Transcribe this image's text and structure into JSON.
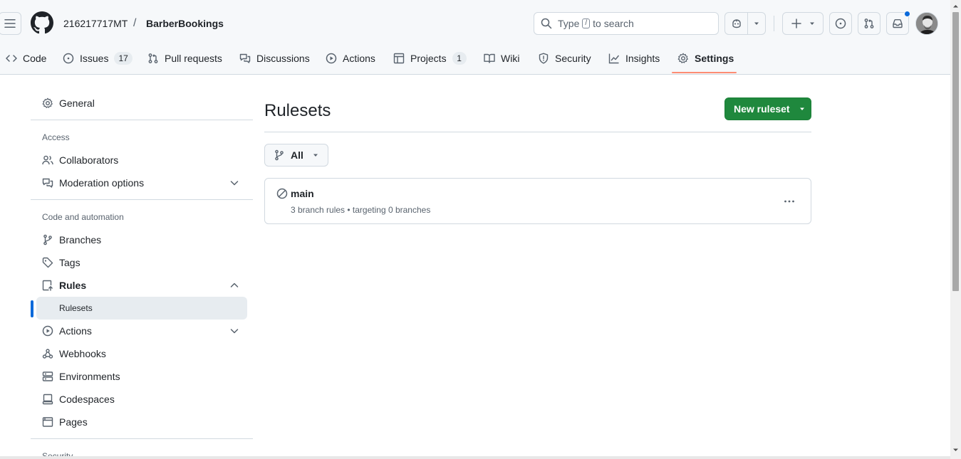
{
  "header": {
    "owner": "216217717MT",
    "separator": "/",
    "repo": "BarberBookings",
    "search": {
      "prefix": "Type",
      "key": "/",
      "suffix": "to search"
    }
  },
  "repo_nav": [
    {
      "label": "Code",
      "icon": "code-icon"
    },
    {
      "label": "Issues",
      "icon": "issue-opened-icon",
      "count": "17"
    },
    {
      "label": "Pull requests",
      "icon": "git-pull-request-icon"
    },
    {
      "label": "Discussions",
      "icon": "comment-discussion-icon"
    },
    {
      "label": "Actions",
      "icon": "play-icon"
    },
    {
      "label": "Projects",
      "icon": "table-icon",
      "count": "1"
    },
    {
      "label": "Wiki",
      "icon": "book-icon"
    },
    {
      "label": "Security",
      "icon": "shield-icon"
    },
    {
      "label": "Insights",
      "icon": "graph-icon"
    },
    {
      "label": "Settings",
      "icon": "gear-icon",
      "selected": true
    }
  ],
  "sidebar": {
    "general": "General",
    "access_heading": "Access",
    "collaborators": "Collaborators",
    "moderation": "Moderation options",
    "code_heading": "Code and automation",
    "branches": "Branches",
    "tags": "Tags",
    "rules": "Rules",
    "rulesets": "Rulesets",
    "actions": "Actions",
    "webhooks": "Webhooks",
    "environments": "Environments",
    "codespaces": "Codespaces",
    "pages": "Pages",
    "security_heading": "Security"
  },
  "main": {
    "title": "Rulesets",
    "new_button": "New ruleset",
    "filter": "All",
    "rulesets": [
      {
        "name": "main",
        "meta": "3 branch rules • targeting 0 branches",
        "status": "disabled"
      }
    ]
  },
  "colors": {
    "primary_button": "#1f883d",
    "active_indicator": "#0969da",
    "nav_underline": "#fd8c73",
    "border": "#d1d9e0",
    "header_bg": "#f6f8fa"
  }
}
